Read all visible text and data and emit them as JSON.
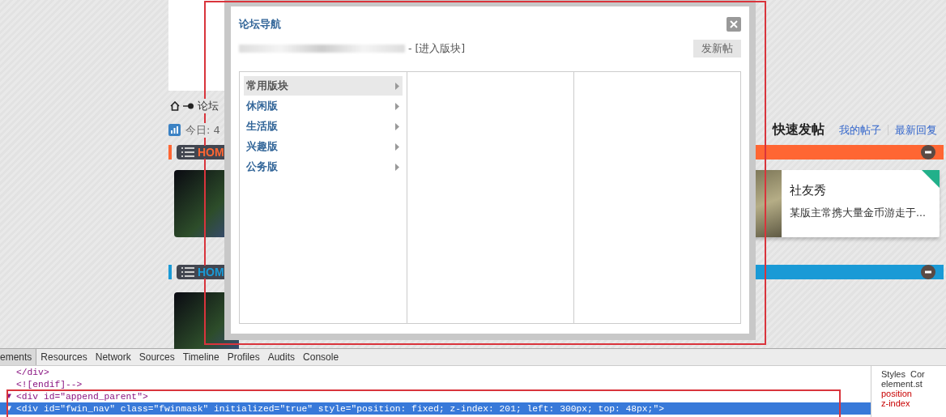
{
  "background": {
    "breadcrumb": "论坛",
    "stats": "今日: 4",
    "quick_post": {
      "title": "快速发帖",
      "links": [
        "我的帖子",
        "最新回复"
      ]
    },
    "sections": [
      {
        "label": "HOM",
        "color": "#ff6633"
      },
      {
        "label": "HOM",
        "color": "#1a9ad6"
      }
    ],
    "card": {
      "title": "社友秀",
      "text": "某版主常携大量金币游走于..."
    }
  },
  "modal": {
    "title": "论坛导航",
    "forum_link": "- [进入版块]",
    "new_post_button": "发新帖",
    "categories": [
      {
        "label": "常用版块",
        "selected": true
      },
      {
        "label": "休闲版",
        "selected": false
      },
      {
        "label": "生活版",
        "selected": false
      },
      {
        "label": "兴趣版",
        "selected": false
      },
      {
        "label": "公务版",
        "selected": false
      }
    ]
  },
  "devtools": {
    "tabs": [
      {
        "label": "ements",
        "selected": true
      },
      {
        "label": "Resources",
        "selected": false
      },
      {
        "label": "Network",
        "selected": false
      },
      {
        "label": "Sources",
        "selected": false
      },
      {
        "label": "Timeline",
        "selected": false
      },
      {
        "label": "Profiles",
        "selected": false
      },
      {
        "label": "Audits",
        "selected": false
      },
      {
        "label": "Console",
        "selected": false
      }
    ],
    "lines": [
      {
        "text": "</div>",
        "selected": false
      },
      {
        "text": "<![endif]-->",
        "selected": false
      },
      {
        "toggle": "▼",
        "text": "<div id=\"append_parent\">",
        "selected": false
      },
      {
        "toggle": "▼",
        "text": "<div id=\"fwin_nav\" class=\"fwinmask\" initialized=\"true\" style=\"position: fixed; z-index: 201; left: 300px; top: 48px;\">",
        "selected": true
      }
    ],
    "side_pane": [
      "Styles",
      "Cor",
      "element.st",
      "position",
      "z-index"
    ]
  }
}
